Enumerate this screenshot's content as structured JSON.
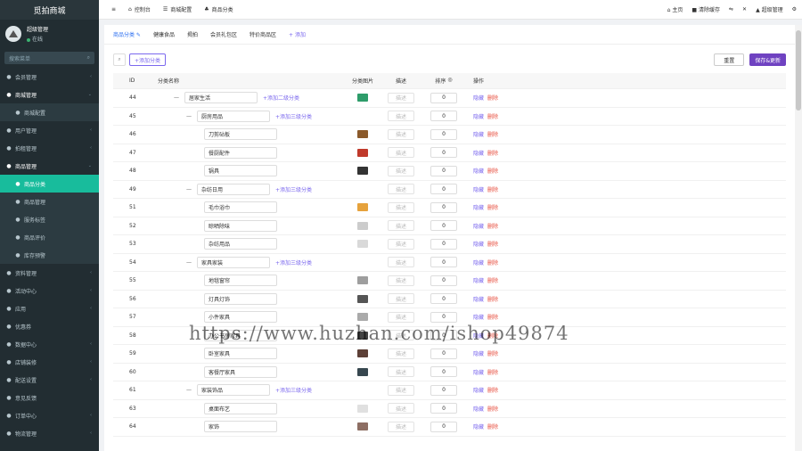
{
  "brand": "觅拍商城",
  "user": {
    "name": "超级管理",
    "status": "在线"
  },
  "side_search_placeholder": "搜索菜单",
  "sidebar": {
    "items": [
      {
        "label": "会员管理",
        "icon": "user-circle-icon",
        "chev": true
      },
      {
        "label": "商城管理",
        "icon": "home-icon",
        "chev": true,
        "open": true
      },
      {
        "label": "商城配置",
        "icon": "settings-icon",
        "sub": true
      },
      {
        "label": "用户管理",
        "icon": "users-icon",
        "chev": true
      },
      {
        "label": "拍租管理",
        "icon": "list-icon",
        "chev": true
      },
      {
        "label": "商品管理",
        "icon": "box-icon",
        "chev": true,
        "open": true
      },
      {
        "label": "商品分类",
        "icon": "hierarchy-icon",
        "sub": true,
        "active": true
      },
      {
        "label": "商品管理",
        "icon": "grid-icon",
        "sub": true
      },
      {
        "label": "服务标签",
        "icon": "tag-icon",
        "sub": true
      },
      {
        "label": "商品评价",
        "icon": "comment-icon",
        "sub": true
      },
      {
        "label": "库存预警",
        "icon": "warning-icon",
        "sub": true
      },
      {
        "label": "资料管理",
        "icon": "file-icon",
        "chev": true
      },
      {
        "label": "活动中心",
        "icon": "flag-icon",
        "chev": true
      },
      {
        "label": "应用",
        "icon": "cloud-icon",
        "chev": true
      },
      {
        "label": "优惠券",
        "icon": "coupon-icon"
      },
      {
        "label": "数据中心",
        "icon": "chart-icon",
        "chev": true
      },
      {
        "label": "店铺装修",
        "icon": "brush-icon",
        "chev": true
      },
      {
        "label": "配送设置",
        "icon": "truck-icon",
        "chev": true
      },
      {
        "label": "意见反馈",
        "icon": "feedback-icon"
      },
      {
        "label": "订单中心",
        "icon": "order-icon",
        "chev": true
      },
      {
        "label": "物流管理",
        "icon": "logistics-icon",
        "chev": true
      }
    ]
  },
  "topbar": {
    "menu_icon": "≡",
    "items": [
      {
        "icon": "dashboard-icon",
        "glyph": "⌂",
        "label": "控制台"
      },
      {
        "icon": "config-icon",
        "glyph": "☰",
        "label": "商城配置"
      },
      {
        "icon": "category-icon",
        "glyph": "♣",
        "label": "商品分类"
      }
    ],
    "right": {
      "home": "主页",
      "clear": "清除缓存",
      "admin": "超级管理"
    }
  },
  "tabs": [
    "商品分类",
    "健康食品",
    "揭拍",
    "会员礼包区",
    "特价商品区"
  ],
  "tab_add": "+ 添加",
  "toolbar": {
    "add_label": "+添加分类",
    "reset_label": "重置",
    "save_label": "保存&更新"
  },
  "table": {
    "headers": {
      "id": "ID",
      "name": "分类名称",
      "img": "分类图片",
      "desc": "描述",
      "sort": "排序",
      "op": "操作"
    },
    "rows": [
      {
        "id": "44",
        "name": "居家生活",
        "level": 1,
        "add": "+添加二级分类",
        "sort": "0",
        "img": "#2e9c6a"
      },
      {
        "id": "45",
        "name": "厨房用品",
        "level": 2,
        "add": "+添加三级分类",
        "sort": "0",
        "img": ""
      },
      {
        "id": "46",
        "name": "刀剪砧板",
        "level": 3,
        "sort": "0",
        "img": "#8b5a2b"
      },
      {
        "id": "47",
        "name": "餐厨配件",
        "level": 3,
        "sort": "0",
        "img": "#c0392b"
      },
      {
        "id": "48",
        "name": "锅具",
        "level": 3,
        "sort": "0",
        "img": "#333333"
      },
      {
        "id": "49",
        "name": "杂纺日用",
        "level": 2,
        "add": "+添加三级分类",
        "sort": "0",
        "img": ""
      },
      {
        "id": "51",
        "name": "毛巾浴巾",
        "level": 3,
        "sort": "0",
        "img": "#e6a23c"
      },
      {
        "id": "52",
        "name": "晾晒除味",
        "level": 3,
        "sort": "0",
        "img": "#cccccc"
      },
      {
        "id": "53",
        "name": "杂纺用品",
        "level": 3,
        "sort": "0",
        "img": "#d9d9d9"
      },
      {
        "id": "54",
        "name": "家具家装",
        "level": 2,
        "add": "+添加三级分类",
        "sort": "0",
        "img": ""
      },
      {
        "id": "55",
        "name": "地毯窗帘",
        "level": 3,
        "sort": "0",
        "img": "#9e9e9e"
      },
      {
        "id": "56",
        "name": "灯具灯饰",
        "level": 3,
        "sort": "0",
        "img": "#555555"
      },
      {
        "id": "57",
        "name": "小件家具",
        "level": 3,
        "sort": "0",
        "img": "#aaaaaa"
      },
      {
        "id": "58",
        "name": "办公书房家具",
        "level": 3,
        "sort": "0",
        "img": "#444444"
      },
      {
        "id": "59",
        "name": "卧室家具",
        "level": 3,
        "sort": "0",
        "img": "#5d4037"
      },
      {
        "id": "60",
        "name": "客餐厅家具",
        "level": 3,
        "sort": "0",
        "img": "#37474f"
      },
      {
        "id": "61",
        "name": "家装饰品",
        "level": 2,
        "add": "+添加三级分类",
        "sort": "0",
        "img": ""
      },
      {
        "id": "63",
        "name": "桌面布艺",
        "level": 3,
        "sort": "0",
        "img": "#e0e0e0"
      },
      {
        "id": "64",
        "name": "家饰",
        "level": 3,
        "sort": "0",
        "img": "#8d6e63"
      }
    ],
    "desc_placeholder": "描述",
    "op_hide": "隐藏",
    "op_del": "删除"
  },
  "watermark": "https://www.huzhan.com/ishop49874"
}
